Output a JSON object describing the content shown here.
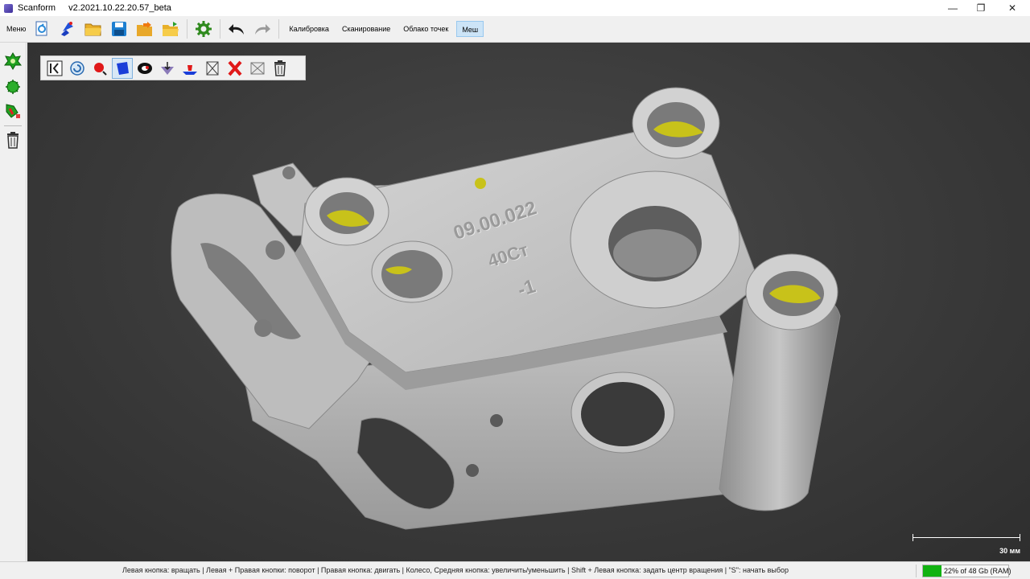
{
  "window": {
    "app_name": "Scanform",
    "version": "v2.2021.10.22.20.57_beta",
    "controls": {
      "minimize": "—",
      "maximize": "❐",
      "close": "✕"
    }
  },
  "toolbar": {
    "menu_label": "Меню",
    "icons": [
      "new-project-icon",
      "import-icon",
      "open-folder-icon",
      "save-icon",
      "export-icon",
      "export-folder-icon",
      "settings-gear-icon",
      "undo-icon",
      "redo-icon"
    ],
    "tabs": [
      {
        "label": "Калибровка",
        "active": false
      },
      {
        "label": "Сканирование",
        "active": false
      },
      {
        "label": "Облако точек",
        "active": false
      },
      {
        "label": "Меш",
        "active": true
      }
    ]
  },
  "sidebar": {
    "icons": [
      "mesh-green-icon",
      "mesh-blob-icon",
      "mesh-edit-icon",
      "trash-icon"
    ]
  },
  "mesh_tools": {
    "icons": [
      "panel-collapse-icon",
      "reset-view-icon",
      "brush-select-icon",
      "polygon-select-icon",
      "ring-select-icon",
      "fill-select-icon",
      "plane-cut-icon",
      "invert-selection-icon",
      "clear-selection-icon",
      "hide-selection-icon",
      "delete-icon"
    ],
    "selected_index": 3
  },
  "viewport": {
    "part_text": [
      "09.00.022",
      "40Ст",
      "-1"
    ],
    "scale_label": "30 мм"
  },
  "status": {
    "hints": "Левая кнопка: вращать  |  Левая + Правая кнопки: поворот  |  Правая кнопка: двигать  |  Колесо, Средняя кнопка: увеличить/уменьшить  |  Shift + Левая кнопка: задать центр вращения  |  \"S\": начать выбор",
    "ram_text": "22% of 48 Gb (RAM)",
    "ram_fraction": 0.22
  },
  "colors": {
    "viewport_bg": "#3a3a3a",
    "mesh": "#c9c9c9",
    "hole_fill": "#c8c21a",
    "active_tab": "#cce4f7",
    "ram_fill": "#11b211"
  }
}
